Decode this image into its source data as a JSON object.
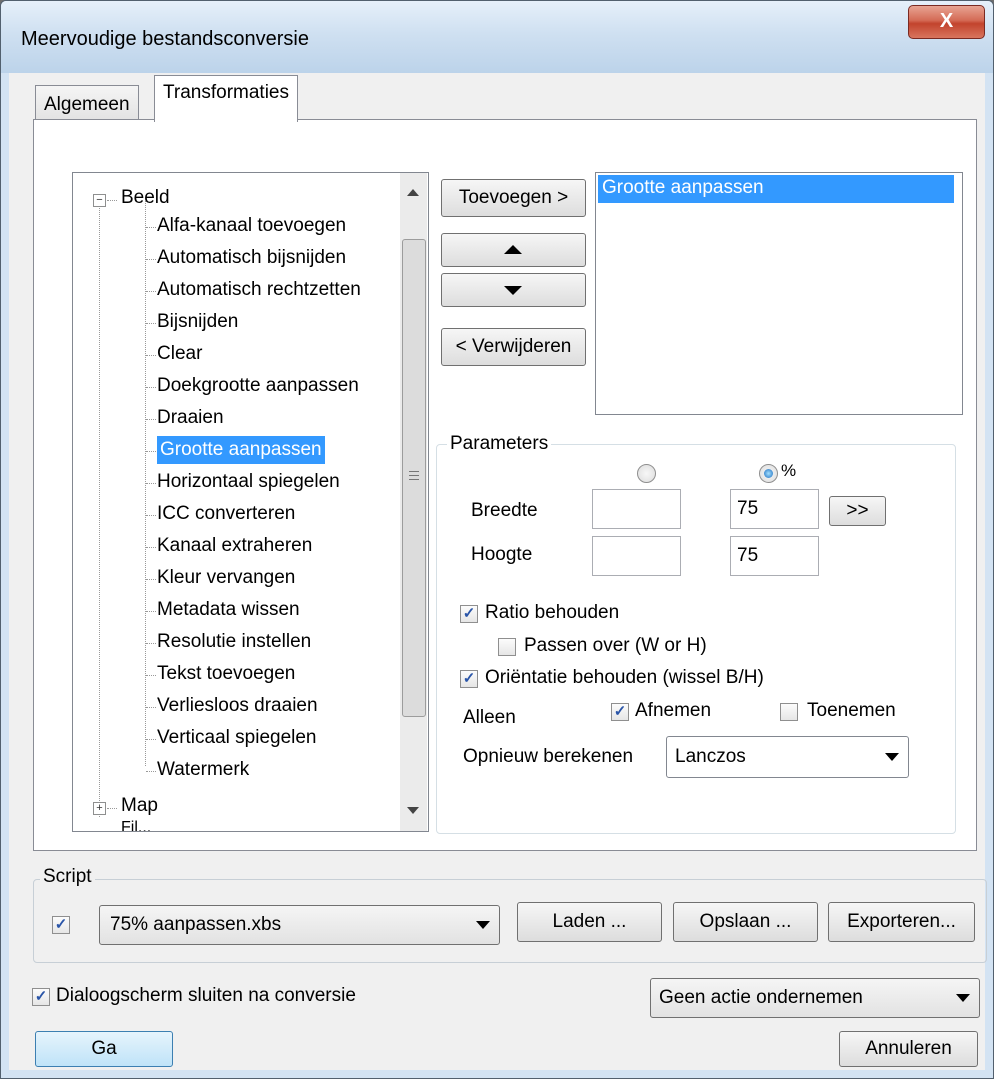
{
  "window": {
    "title": "Meervoudige bestandsconversie",
    "close_label": "X"
  },
  "tabs": [
    {
      "label": "Algemeen"
    },
    {
      "label": "Transformaties"
    }
  ],
  "tree": {
    "root": "Beeld",
    "children": [
      "Alfa-kanaal toevoegen",
      "Automatisch bijsnijden",
      "Automatisch rechtzetten",
      "Bijsnijden",
      "Clear",
      "Doekgrootte aanpassen",
      "Draaien",
      "Grootte aanpassen",
      "Horizontaal spiegelen",
      "ICC converteren",
      "Kanaal extraheren",
      "Kleur vervangen",
      "Metadata wissen",
      "Resolutie instellen",
      "Tekst toevoegen",
      "Verliesloos draaien",
      "Verticaal spiegelen",
      "Watermerk"
    ],
    "selected": "Grootte aanpassen",
    "next_root": "Map",
    "partial_root": "Fil..."
  },
  "buttons": {
    "add": "Toevoegen >",
    "remove": "< Verwijderen",
    "expand": ">>",
    "load": "Laden ...",
    "save": "Opslaan ...",
    "export": "Exporteren...",
    "go": "Ga",
    "cancel": "Annuleren"
  },
  "applied_list": [
    "Grootte aanpassen"
  ],
  "parameters": {
    "title": "Parameters",
    "percent_label": "%",
    "width_label": "Breedte",
    "height_label": "Hoogte",
    "width_px": "",
    "height_px": "",
    "width_pct": "75",
    "height_pct": "75",
    "keep_ratio": "Ratio behouden",
    "fit_over": "Passen over (W or H)",
    "keep_orientation": "Oriëntatie behouden (wissel B/H)",
    "only_label": "Alleen",
    "decrease": "Afnemen",
    "increase": "Toenemen",
    "resample_label": "Opnieuw berekenen",
    "resample_value": "Lanczos"
  },
  "script": {
    "label": "Script",
    "file": "75% aanpassen.xbs"
  },
  "footer": {
    "close_after": "Dialoogscherm sluiten na conversie",
    "after_action": "Geen actie ondernemen"
  },
  "icons": {
    "check": "✓"
  }
}
